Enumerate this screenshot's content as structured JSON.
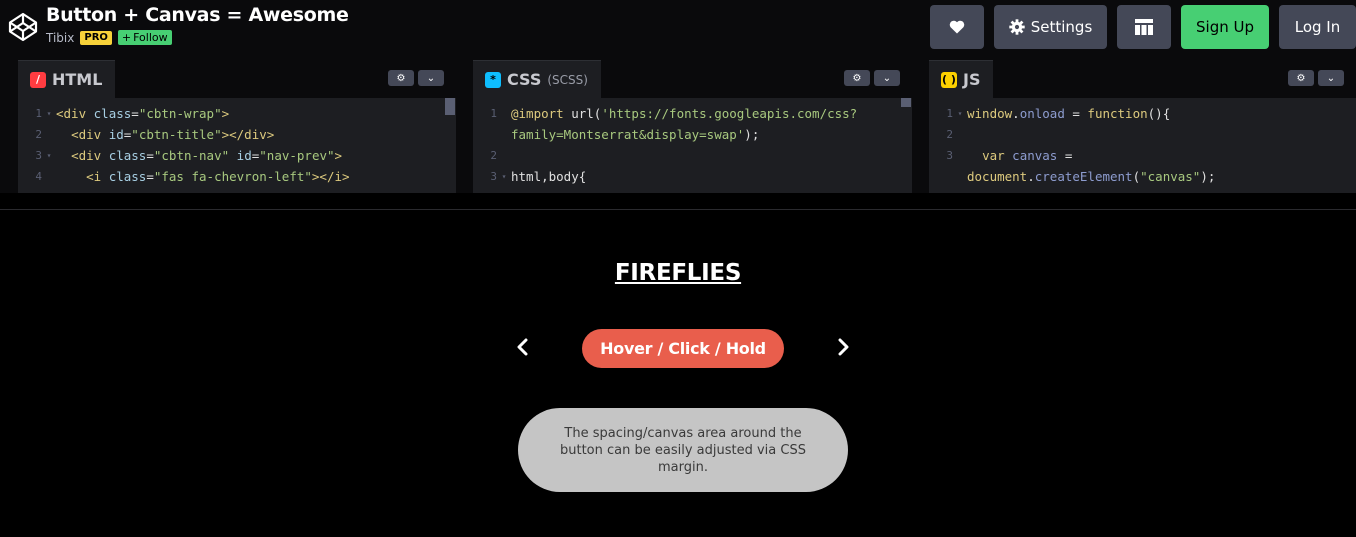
{
  "header": {
    "title": "Button + Canvas = Awesome",
    "author": "Tibix",
    "pro_badge": "PRO",
    "follow_label": "Follow",
    "settings_label": "Settings",
    "signup_label": "Sign Up",
    "login_label": "Log In",
    "icons": [
      "codepen-logo-icon",
      "heart-icon",
      "gear-icon",
      "layout-icon",
      "plus-icon"
    ]
  },
  "editors": {
    "html": {
      "tab_label": "HTML",
      "lines": [
        {
          "n": "1",
          "fold": "▾",
          "segments": [
            [
              "t-tag",
              "<div "
            ],
            [
              "t-attr",
              "class"
            ],
            [
              "t-plain",
              "="
            ],
            [
              "t-str",
              "\"cbtn-wrap\""
            ],
            [
              "t-tag",
              ">"
            ]
          ]
        },
        {
          "n": "2",
          "fold": "",
          "segments": [
            [
              "t-plain",
              "  "
            ],
            [
              "t-tag",
              "<div "
            ],
            [
              "t-attr",
              "id"
            ],
            [
              "t-plain",
              "="
            ],
            [
              "t-str",
              "\"cbtn-title\""
            ],
            [
              "t-tag",
              "></div>"
            ]
          ]
        },
        {
          "n": "3",
          "fold": "▾",
          "segments": [
            [
              "t-plain",
              "  "
            ],
            [
              "t-tag",
              "<div "
            ],
            [
              "t-attr",
              "class"
            ],
            [
              "t-plain",
              "="
            ],
            [
              "t-str",
              "\"cbtn-nav\" "
            ],
            [
              "t-attr",
              "id"
            ],
            [
              "t-plain",
              "="
            ],
            [
              "t-str",
              "\"nav-prev\""
            ],
            [
              "t-tag",
              ">"
            ]
          ]
        },
        {
          "n": "4",
          "fold": "",
          "segments": [
            [
              "t-plain",
              "    "
            ],
            [
              "t-tag",
              "<i "
            ],
            [
              "t-attr",
              "class"
            ],
            [
              "t-plain",
              "="
            ],
            [
              "t-str",
              "\"fas fa-chevron-left\""
            ],
            [
              "t-tag",
              "></i>"
            ]
          ]
        }
      ]
    },
    "css": {
      "tab_label": "CSS",
      "tab_sub": "(SCSS)",
      "lines": [
        {
          "n": "1",
          "fold": "",
          "segments": [
            [
              "t-kw",
              "@import "
            ],
            [
              "t-plain",
              "url("
            ],
            [
              "t-str",
              "'https://fonts.googleapis.com/css?"
            ]
          ]
        },
        {
          "n": "",
          "fold": "",
          "segments": [
            [
              "t-str",
              "family=Montserrat&display=swap'"
            ],
            [
              "t-plain",
              ");"
            ]
          ]
        },
        {
          "n": "2",
          "fold": "",
          "segments": []
        },
        {
          "n": "3",
          "fold": "▾",
          "segments": [
            [
              "t-plain",
              "html,body{"
            ]
          ]
        }
      ]
    },
    "js": {
      "tab_label": "JS",
      "lines": [
        {
          "n": "1",
          "fold": "▾",
          "segments": [
            [
              "t-kw",
              "window"
            ],
            [
              "t-plain",
              "."
            ],
            [
              "t-var",
              "onload"
            ],
            [
              "t-plain",
              " = "
            ],
            [
              "t-kw",
              "function"
            ],
            [
              "t-plain",
              "(){"
            ]
          ]
        },
        {
          "n": "2",
          "fold": "",
          "segments": []
        },
        {
          "n": "3",
          "fold": "",
          "segments": [
            [
              "t-plain",
              "  "
            ],
            [
              "t-kw",
              "var "
            ],
            [
              "t-var",
              "canvas"
            ],
            [
              "t-plain",
              " ="
            ]
          ]
        },
        {
          "n": "",
          "fold": "",
          "segments": [
            [
              "t-kw",
              "document"
            ],
            [
              "t-plain",
              "."
            ],
            [
              "t-var",
              "createElement"
            ],
            [
              "t-plain",
              "("
            ],
            [
              "t-str",
              "\"canvas\""
            ],
            [
              "t-plain",
              ");"
            ]
          ]
        }
      ]
    }
  },
  "preview": {
    "title": "FIREFLIES",
    "button_label": "Hover / Click / Hold",
    "note": "The spacing/canvas area around the button can be easily adjusted via CSS margin.",
    "button_color": "#e95e4c",
    "note_bg": "#c5c5c5"
  },
  "colors": {
    "signup_green": "#47cf73",
    "pro_yellow": "#f7d23a",
    "header_button": "#444857",
    "editor_bg": "#1d1e22"
  }
}
